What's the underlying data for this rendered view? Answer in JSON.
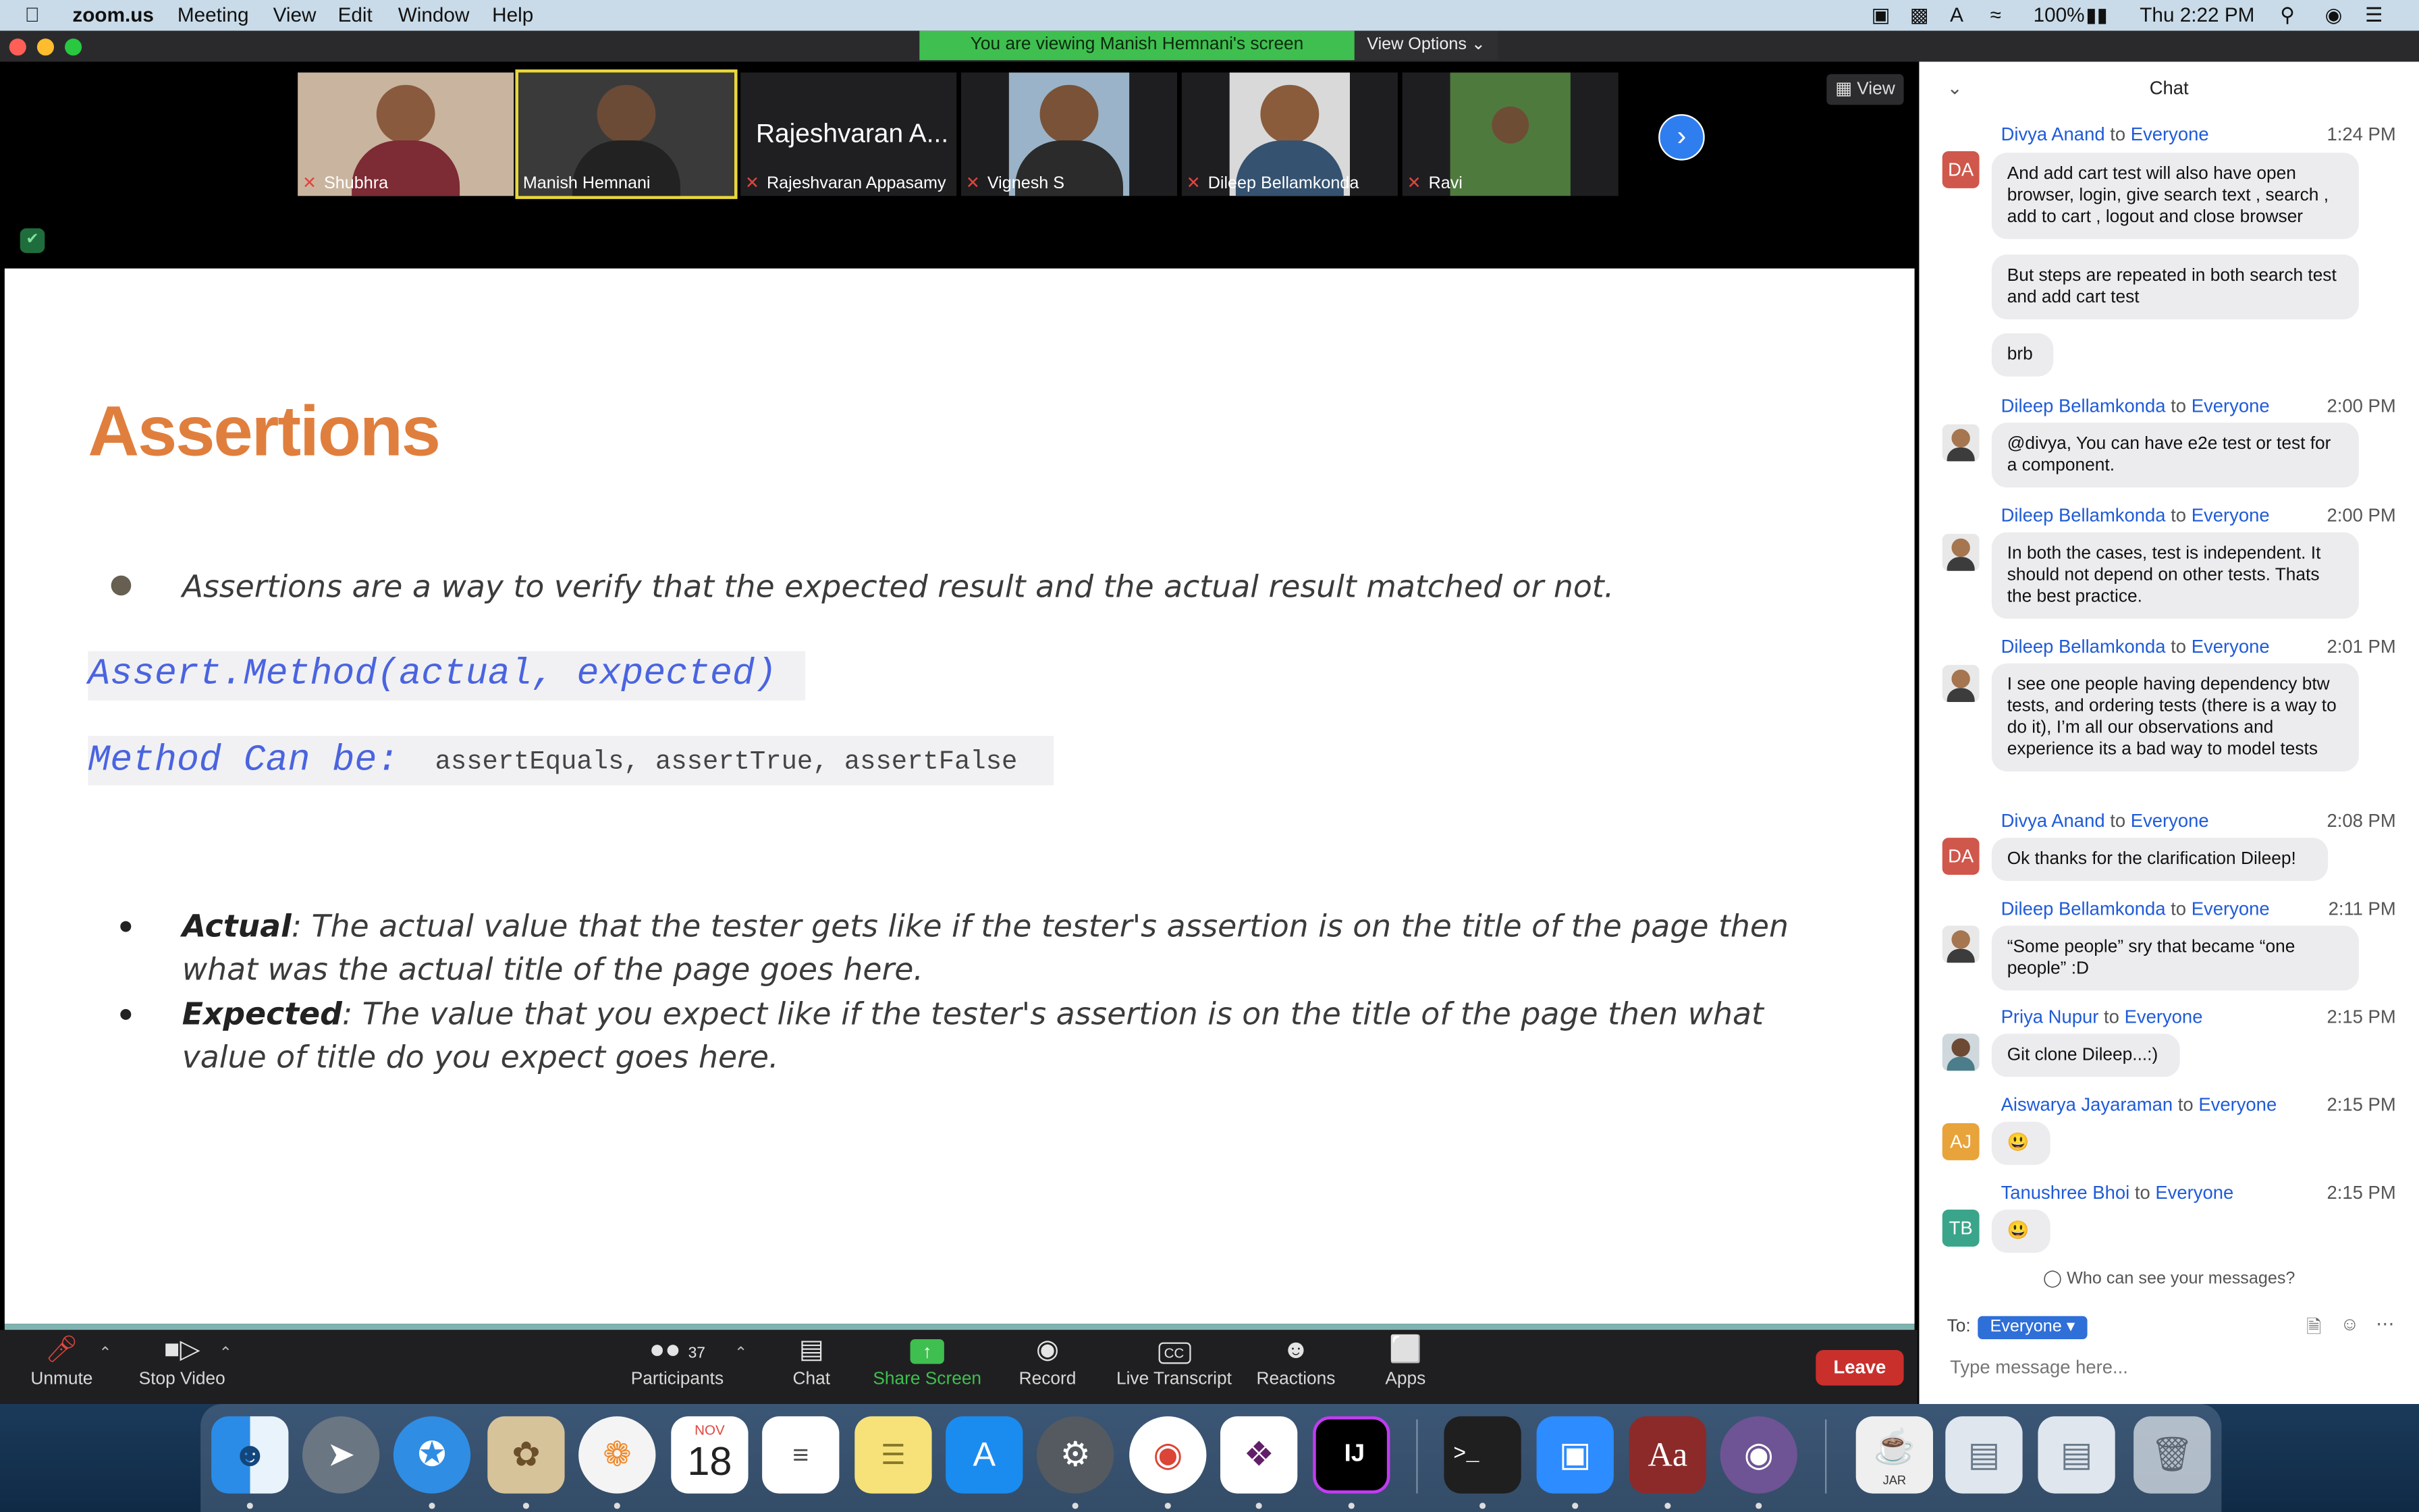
{
  "menubar": {
    "app_name": "zoom.us",
    "items": [
      "Meeting",
      "View",
      "Edit",
      "Window",
      "Help"
    ],
    "battery": "100%",
    "clock": "Thu 2:22 PM"
  },
  "share": {
    "banner": "You are viewing Manish Hemnani's screen",
    "view_options": "View Options ⌄"
  },
  "participants_strip": [
    {
      "name": "Shubhra",
      "muted": true
    },
    {
      "name": "Manish Hemnani",
      "muted": false
    },
    {
      "name": "Rajeshvaran Appasamy",
      "display": "Rajeshvaran A...",
      "muted": true
    },
    {
      "name": "Vignesh S",
      "muted": true
    },
    {
      "name": "Dileep Bellamkonda",
      "muted": true
    },
    {
      "name": "Ravi",
      "muted": true
    }
  ],
  "view_button": "View",
  "slide": {
    "title": "Assertions",
    "bullet1": "Assertions are a way to verify that the expected result and the actual result matched or not.",
    "code_line": "Assert.Method(actual, expected)",
    "method_label": "Method Can be:",
    "method_values": "assertEquals, assertTrue, assertFalse",
    "actual_term": "Actual",
    "actual_text": ": The actual value that the tester gets like if the tester's assertion is on the title of the page then what was the actual title of the page goes here.",
    "expected_term": "Expected",
    "expected_text": ": The value that you expect like if the tester's assertion is on the title of the page then what value of title do you expect goes here."
  },
  "toolbar": {
    "unmute": "Unmute",
    "stop_video": "Stop Video",
    "participants": "Participants",
    "participant_count": "37",
    "chat": "Chat",
    "share_screen": "Share Screen",
    "record": "Record",
    "live_transcript": "Live Transcript",
    "reactions": "Reactions",
    "apps": "Apps",
    "leave": "Leave"
  },
  "chat": {
    "title": "Chat",
    "to_word": "to",
    "messages": [
      {
        "sender": "Divya Anand",
        "to": "Everyone",
        "time": "1:24 PM",
        "avatar": "DA",
        "lines": [
          "And add cart test will also have open browser, login, give search text , search , add to cart , logout and close browser",
          "But steps are repeated in both search test and add cart test",
          "brb"
        ]
      },
      {
        "sender": "Dileep Bellamkonda",
        "to": "Everyone",
        "time": "2:00 PM",
        "lines": [
          "@divya, You can have e2e test or test for a component."
        ]
      },
      {
        "sender": "Dileep Bellamkonda",
        "to": "Everyone",
        "time": "2:00 PM",
        "lines": [
          "In both the cases, test is independent. It should not depend on other tests. Thats the best practice."
        ]
      },
      {
        "sender": "Dileep Bellamkonda",
        "to": "Everyone",
        "time": "2:01 PM",
        "lines": [
          "I see one people having dependency btw tests, and ordering tests (there is a way to do it), I’m all our observations and experience its a bad way to model tests"
        ]
      },
      {
        "sender": "Divya Anand",
        "to": "Everyone",
        "time": "2:08 PM",
        "avatar": "DA",
        "lines": [
          "Ok thanks for the clarification Dileep!"
        ]
      },
      {
        "sender": "Dileep Bellamkonda",
        "to": "Everyone",
        "time": "2:11 PM",
        "lines": [
          "“Some people” sry that became “one people” :D"
        ]
      },
      {
        "sender": "Priya Nupur",
        "to": "Everyone",
        "time": "2:15 PM",
        "lines": [
          "Git clone Dileep...:)"
        ]
      },
      {
        "sender": "Aiswarya Jayaraman",
        "to": "Everyone",
        "time": "2:15 PM",
        "avatar": "AJ",
        "lines": [
          "😃"
        ]
      },
      {
        "sender": "Tanushree Bhoi",
        "to": "Everyone",
        "time": "2:15 PM",
        "avatar": "TB",
        "lines": [
          "😃"
        ]
      }
    ],
    "who_can_see": "Who can see your messages?",
    "to_label": "To:",
    "to_value": "Everyone ▾",
    "input_placeholder": "Type message here..."
  },
  "dock": {
    "calendar_month": "NOV",
    "calendar_day": "18",
    "jar_label": "JAR"
  },
  "colors": {
    "share_green": "#3fbf4f",
    "slide_title_orange": "#e07f3d",
    "code_blue": "#4a64e0",
    "leave_red": "#c9302c",
    "chat_link_blue": "#1f5bd8"
  }
}
